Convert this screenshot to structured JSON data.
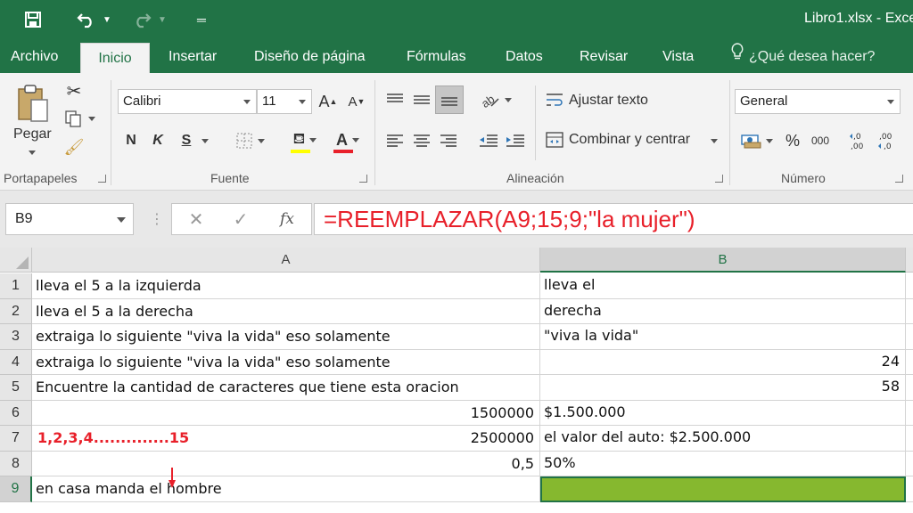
{
  "window": {
    "title": "Libro1.xlsx - Exce"
  },
  "ribbon_tabs": [
    "Archivo",
    "Inicio",
    "Insertar",
    "Diseño de página",
    "Fórmulas",
    "Datos",
    "Revisar",
    "Vista"
  ],
  "active_tab": "Inicio",
  "tell_me": "¿Qué desea hacer?",
  "groups": {
    "clipboard": {
      "paste": "Pegar",
      "label": "Portapapeles"
    },
    "font": {
      "name": "Calibri",
      "size": "11",
      "bold": "N",
      "italic": "K",
      "underline": "S",
      "label": "Fuente"
    },
    "alignment": {
      "wrap": "Ajustar texto",
      "merge": "Combinar y centrar",
      "label": "Alineación"
    },
    "number": {
      "format": "General",
      "percent": "%",
      "thousands": "000",
      "label": "Número"
    }
  },
  "formula_bar": {
    "name_box": "B9",
    "fx": "fx",
    "formula": "=REEMPLAZAR(A9;15;9;\"la mujer\")"
  },
  "sheet": {
    "columns": [
      "A",
      "B"
    ],
    "selected_column": "B",
    "selected_row": "9",
    "rows": [
      {
        "num": "1",
        "a": "lleva el 5 a la izquierda",
        "b": "lleva el"
      },
      {
        "num": "2",
        "a": "lleva el 5 a la derecha",
        "b": "derecha"
      },
      {
        "num": "3",
        "a": "extraiga lo siguiente \"viva la vida\" eso solamente",
        "b": "\"viva la vida\""
      },
      {
        "num": "4",
        "a": "extraiga lo siguiente \"viva la vida\" eso solamente",
        "b": "24"
      },
      {
        "num": "5",
        "a": "Encuentre la cantidad de caracteres que tiene esta oracion",
        "b": "58"
      },
      {
        "num": "6",
        "a": "1500000",
        "b": "$1.500.000"
      },
      {
        "num": "7",
        "a": "2500000",
        "b": "el valor del auto: $2.500.000"
      },
      {
        "num": "8",
        "a": "0,5",
        "b": "50%"
      },
      {
        "num": "9",
        "a": "en casa manda el hombre",
        "b": ""
      }
    ],
    "annotation": "1,2,3,4..............15"
  },
  "colors": {
    "excel_green": "#217346",
    "selection_fill": "#86b82f",
    "annotation_red": "#e8202a"
  }
}
